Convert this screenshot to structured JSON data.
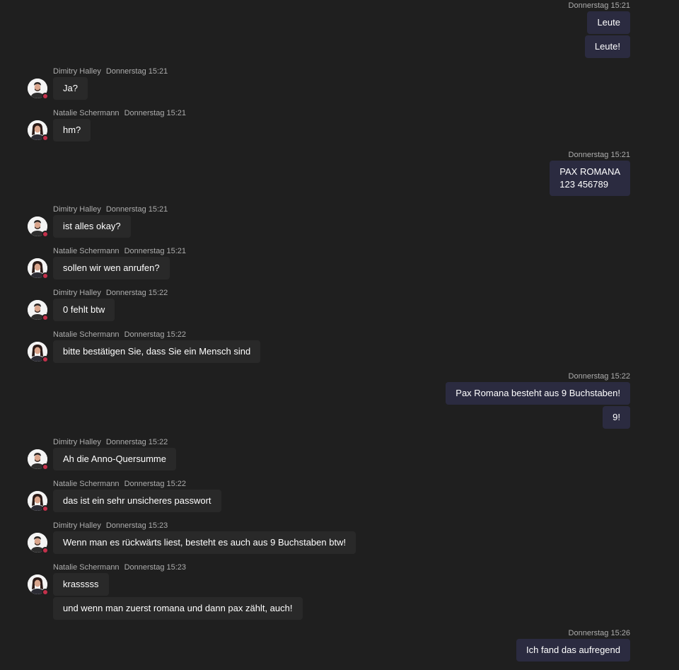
{
  "messages": [
    {
      "id": "m1",
      "mine": true,
      "time": "Donnerstag 15:21",
      "lines": [
        "Leute",
        "Leute!"
      ]
    },
    {
      "id": "m2",
      "mine": false,
      "author": "Dimitry Halley",
      "time": "Donnerstag 15:21",
      "lines": [
        "Ja?"
      ]
    },
    {
      "id": "m3",
      "mine": false,
      "author": "Natalie Schermann",
      "time": "Donnerstag 15:21",
      "lines": [
        "hm?"
      ]
    },
    {
      "id": "m4",
      "mine": true,
      "time": "Donnerstag 15:21",
      "lines": [
        "PAX ROMANA\n123 456789"
      ]
    },
    {
      "id": "m5",
      "mine": false,
      "author": "Dimitry Halley",
      "time": "Donnerstag 15:21",
      "lines": [
        "ist alles okay?"
      ]
    },
    {
      "id": "m6",
      "mine": false,
      "author": "Natalie Schermann",
      "time": "Donnerstag 15:21",
      "lines": [
        "sollen wir wen anrufen?"
      ]
    },
    {
      "id": "m7",
      "mine": false,
      "author": "Dimitry Halley",
      "time": "Donnerstag 15:22",
      "lines": [
        "0 fehlt btw"
      ]
    },
    {
      "id": "m8",
      "mine": false,
      "author": "Natalie Schermann",
      "time": "Donnerstag 15:22",
      "lines": [
        "bitte bestätigen Sie, dass Sie ein Mensch sind"
      ]
    },
    {
      "id": "m9",
      "mine": true,
      "time": "Donnerstag 15:22",
      "lines": [
        "Pax Romana besteht aus 9 Buchstaben!",
        "9!"
      ]
    },
    {
      "id": "m10",
      "mine": false,
      "author": "Dimitry Halley",
      "time": "Donnerstag 15:22",
      "lines": [
        "Ah die Anno-Quersumme"
      ]
    },
    {
      "id": "m11",
      "mine": false,
      "author": "Natalie Schermann",
      "time": "Donnerstag 15:22",
      "lines": [
        "das ist ein sehr unsicheres passwort"
      ]
    },
    {
      "id": "m12",
      "mine": false,
      "author": "Dimitry Halley",
      "time": "Donnerstag 15:23",
      "lines": [
        "Wenn man es rückwärts liest, besteht es auch aus 9 Buchstaben btw!"
      ]
    },
    {
      "id": "m13",
      "mine": false,
      "author": "Natalie Schermann",
      "time": "Donnerstag 15:23",
      "lines": [
        "krasssss",
        "und wenn man zuerst romana und dann pax zählt, auch!"
      ]
    },
    {
      "id": "m14",
      "mine": true,
      "time": "Donnerstag 15:26",
      "lines": [
        "Ich fand das aufregend"
      ]
    }
  ],
  "colors": {
    "background": "#1f1f1f",
    "own_bubble": "#2b2b40",
    "other_bubble": "#292929",
    "presence_busy": "#c4314b",
    "meta_text": "#adadad"
  }
}
